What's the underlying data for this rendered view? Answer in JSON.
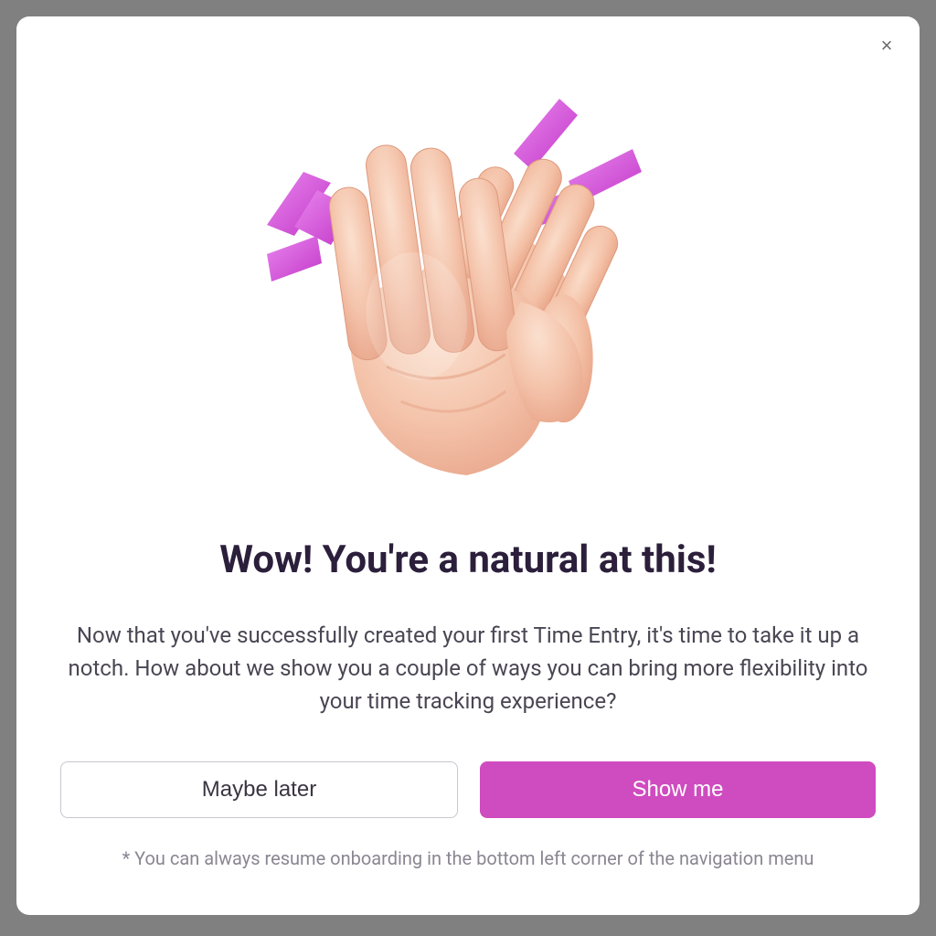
{
  "modal": {
    "close_label": "×",
    "illustration_name": "clapping-hands",
    "title": "Wow! You're a natural at this!",
    "body": "Now that you've successfully created your first Time Entry, it's time to take it up a notch. How about we show you a couple of ways you can bring more flexibility into your time tracking experience?",
    "buttons": {
      "secondary": "Maybe later",
      "primary": "Show me"
    },
    "footnote": "* You can always resume onboarding in the bottom left corner of the navigation menu"
  },
  "colors": {
    "accent": "#cf4bc0",
    "title": "#2b1f3b",
    "body": "#4a4653",
    "muted": "#8a8692",
    "skin_light": "#f7c9b3",
    "skin_mid": "#efb49a",
    "skin_dark": "#e6a084",
    "spark": "#d24fd6"
  }
}
